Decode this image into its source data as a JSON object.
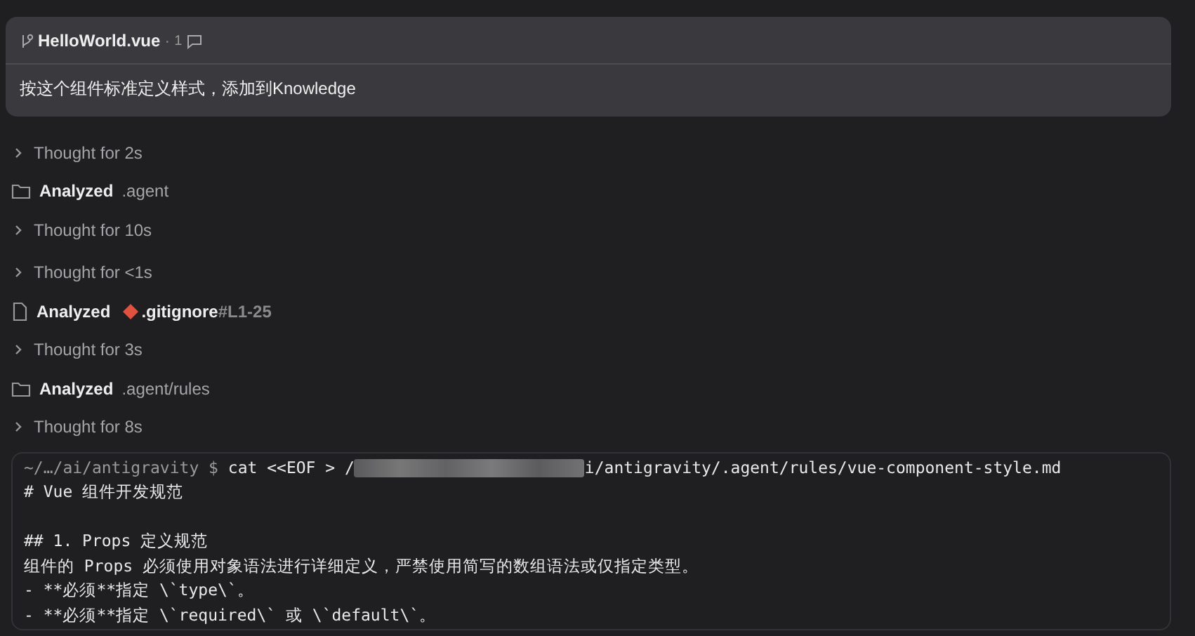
{
  "message_card": {
    "file_name": "HelloWorld.vue",
    "separator": "·",
    "comment_count": "1",
    "text": "按这个组件标准定义样式，添加到Knowledge"
  },
  "steps": [
    {
      "kind": "thought",
      "label": "Thought for 2s"
    },
    {
      "kind": "folder",
      "label": "Analyzed",
      "target": ".agent"
    },
    {
      "kind": "thought",
      "label": "Thought for 10s"
    },
    {
      "kind": "thought",
      "label": "Thought for <1s"
    },
    {
      "kind": "gitfile",
      "label": "Analyzed",
      "target": ".gitignore",
      "suffix": "#L1-25"
    },
    {
      "kind": "thought",
      "label": "Thought for 3s"
    },
    {
      "kind": "folder",
      "label": "Analyzed",
      "target": ".agent/rules"
    },
    {
      "kind": "thought",
      "label": "Thought for 8s"
    }
  ],
  "terminal": {
    "prompt": "~/…/ai/antigravity $",
    "command_start": "cat <<EOF > /",
    "redacted": true,
    "command_end": "i/antigravity/.agent/rules/vue-component-style.md",
    "blocks": [
      [
        "# Vue 组件开发规范"
      ],
      [
        "## 1. Props 定义规范",
        "组件的 Props 必须使用对象语法进行详细定义，严禁使用简写的数组语法或仅指定类型。",
        "- **必须**指定 \\`type\\`。",
        "- **必须**指定 \\`required\\` 或 \\`default\\`。"
      ]
    ]
  }
}
